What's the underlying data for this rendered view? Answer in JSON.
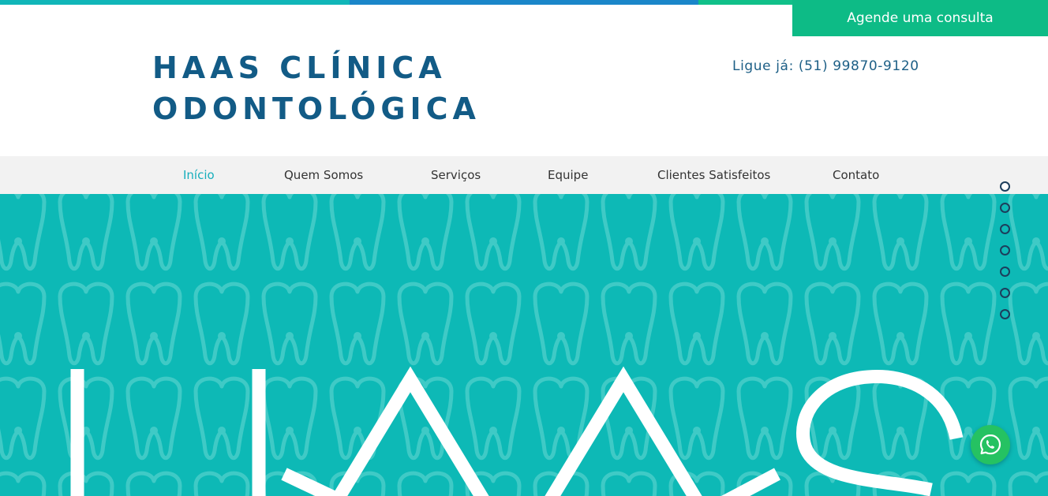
{
  "colors": {
    "topbar": [
      "#10b6b8",
      "#1a86c9",
      "#10c089"
    ],
    "cta": "#0dbb86",
    "brand": "#125b86",
    "nav_active": "#16aebc",
    "hero": "#0db9b6",
    "whatsapp": "#25c262"
  },
  "header": {
    "cta_label": "Agende uma consulta",
    "logo_line1": "HAAS CLÍNICA",
    "logo_line2": "ODONTOLÓGICA",
    "phone": "Ligue já: (51) 99870-9120"
  },
  "nav": {
    "items": [
      {
        "label": "Início",
        "active": true
      },
      {
        "label": "Quem Somos",
        "active": false
      },
      {
        "label": "Serviços",
        "active": false
      },
      {
        "label": "Equipe",
        "active": false
      },
      {
        "label": "Clientes Satisfeitos",
        "active": false
      },
      {
        "label": "Contato",
        "active": false
      }
    ]
  },
  "section_dots": {
    "count": 7,
    "active_index": 0
  },
  "hero": {
    "logo_text": "HAAS",
    "pattern_icon": "tooth-icon"
  },
  "floating": {
    "icon": "whatsapp-icon"
  }
}
